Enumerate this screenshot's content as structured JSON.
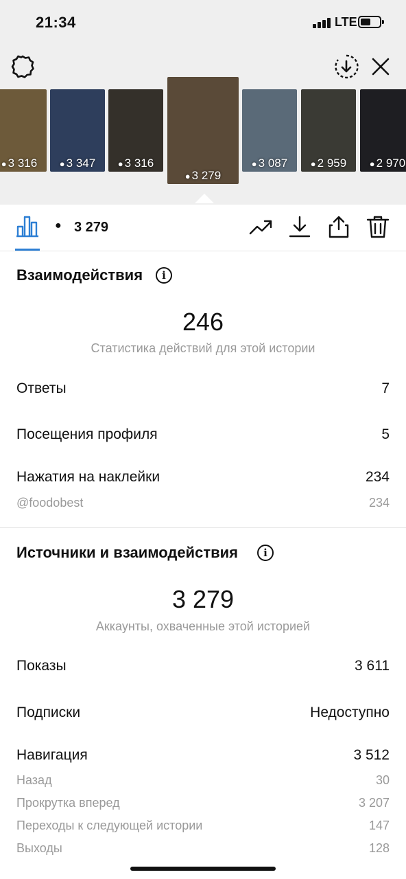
{
  "status_bar": {
    "time": "21:34",
    "network": "LTE"
  },
  "stories": [
    {
      "views": "3 316",
      "bg": "#6d5a3a"
    },
    {
      "views": "3 347",
      "bg": "#2e3e5c"
    },
    {
      "views": "3 316",
      "bg": "#34302a"
    },
    {
      "views": "3 279",
      "bg": "#5a4a38",
      "selected": true
    },
    {
      "views": "3 087",
      "bg": "#5a6a78"
    },
    {
      "views": "2 959",
      "bg": "#3a3a34"
    },
    {
      "views": "2 970",
      "bg": "#1e1e22"
    }
  ],
  "toolbar": {
    "views": "3 279",
    "accent": "#2d7fd4"
  },
  "interactions": {
    "title": "Взаимодействия",
    "total": "246",
    "subtitle": "Статистика действий для этой истории",
    "replies_label": "Ответы",
    "replies_value": "7",
    "profile_visits_label": "Посещения профиля",
    "profile_visits_value": "5",
    "sticker_taps_label": "Нажатия на наклейки",
    "sticker_taps_value": "234",
    "mention_label": "@foodobest",
    "mention_value": "234"
  },
  "discovery": {
    "title": "Источники и взаимодействия",
    "total": "3 279",
    "subtitle": "Аккаунты, охваченные этой историей",
    "impressions_label": "Показы",
    "impressions_value": "3 611",
    "follows_label": "Подписки",
    "follows_value": "Недоступно",
    "navigation_label": "Навигация",
    "navigation_value": "3 512",
    "back_label": "Назад",
    "back_value": "30",
    "forward_label": "Прокрутка вперед",
    "forward_value": "3 207",
    "next_story_label": "Переходы к следующей истории",
    "next_story_value": "147",
    "exits_label": "Выходы",
    "exits_value": "128"
  }
}
